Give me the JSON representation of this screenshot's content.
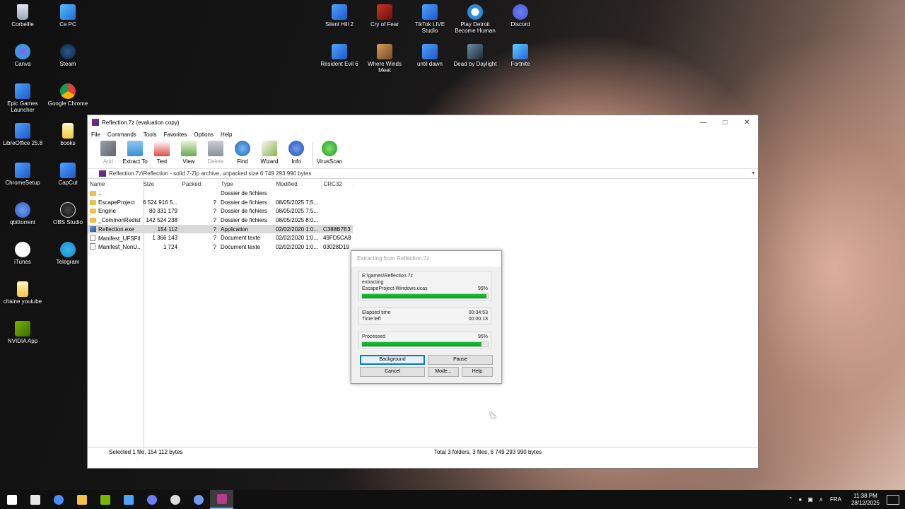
{
  "desktop": {
    "icons": [
      {
        "label": "Corbeille",
        "icon": "recycle-bin-icon"
      },
      {
        "label": "Ce PC",
        "icon": "this-pc-icon"
      },
      {
        "label": "Canva",
        "icon": "canva-icon"
      },
      {
        "label": "Steam",
        "icon": "steam-icon"
      },
      {
        "label": "Epic Games Launcher",
        "icon": "epic-games-icon"
      },
      {
        "label": "Google Chrome",
        "icon": "chrome-icon"
      },
      {
        "label": "LibreOffice 25.8",
        "icon": "libreoffice-icon"
      },
      {
        "label": "books",
        "icon": "folder-document-icon"
      },
      {
        "label": "ChromeSetup",
        "icon": "setup-icon"
      },
      {
        "label": "CapCut",
        "icon": "capcut-icon"
      },
      {
        "label": "qbittorrent",
        "icon": "qbittorrent-icon"
      },
      {
        "label": "OBS Studio",
        "icon": "obs-icon"
      },
      {
        "label": "iTunes",
        "icon": "itunes-icon"
      },
      {
        "label": "Telegram",
        "icon": "telegram-icon"
      },
      {
        "label": "chaine youtube",
        "icon": "document-icon"
      },
      {
        "label": "NVIDIA App",
        "icon": "nvidia-icon"
      },
      {
        "label": "Silent Hill 2",
        "icon": "game-shortcut-icon"
      },
      {
        "label": "Cry of Fear",
        "icon": "cry-of-fear-icon"
      },
      {
        "label": "TikTok LIVE Studio",
        "icon": "tiktok-studio-icon"
      },
      {
        "label": "Play Detroit Become Human",
        "icon": "detroit-icon"
      },
      {
        "label": "Discord",
        "icon": "discord-icon"
      },
      {
        "label": "Resident Evil 6",
        "icon": "game-shortcut-icon"
      },
      {
        "label": "Where Winds Meet",
        "icon": "where-winds-meet-icon"
      },
      {
        "label": "until dawn",
        "icon": "game-shortcut-icon"
      },
      {
        "label": "Dead by Daylight",
        "icon": "dbd-icon"
      },
      {
        "label": "Fortnite",
        "icon": "fortnite-icon"
      }
    ]
  },
  "window": {
    "title": "Reflection.7z (evaluation copy)",
    "menu": [
      "File",
      "Commands",
      "Tools",
      "Favorites",
      "Options",
      "Help"
    ],
    "toolbar": [
      {
        "label": "Add",
        "icon": "add-archive-icon",
        "disabled": true
      },
      {
        "label": "Extract To",
        "icon": "extract-folder-icon",
        "disabled": false
      },
      {
        "label": "Test",
        "icon": "test-archive-icon",
        "disabled": false
      },
      {
        "label": "View",
        "icon": "view-book-icon",
        "disabled": false
      },
      {
        "label": "Delete",
        "icon": "trash-icon",
        "disabled": true
      },
      {
        "label": "Find",
        "icon": "magnifier-icon",
        "disabled": false
      },
      {
        "label": "Wizard",
        "icon": "wizard-wand-icon",
        "disabled": false
      },
      {
        "label": "Info",
        "icon": "info-icon",
        "disabled": false
      },
      {
        "label": "VirusScan",
        "icon": "virus-scan-icon",
        "disabled": false
      }
    ],
    "address": "Reflection.7z\\Reflection - solid 7-Zip archive, unpacked size 6 749 293 990 bytes",
    "columns": [
      "Name",
      "Size",
      "Packed",
      "Type",
      "Modified",
      "CRC32"
    ],
    "files": [
      {
        "name": "..",
        "size": "",
        "packed": "",
        "type": "Dossier de fichiers",
        "modified": "",
        "crc": "",
        "kind": "folder",
        "selected": false
      },
      {
        "name": "EscapeProject",
        "size": "6 524 916 5...",
        "packed": "?",
        "type": "Dossier de fichiers",
        "modified": "08/05/2025 7:5...",
        "crc": "",
        "kind": "folder",
        "selected": false
      },
      {
        "name": "Engine",
        "size": "80 331 179",
        "packed": "?",
        "type": "Dossier de fichiers",
        "modified": "08/05/2025 7:5...",
        "crc": "",
        "kind": "folder",
        "selected": false
      },
      {
        "name": "_CommonRedist",
        "size": "142 524 238",
        "packed": "?",
        "type": "Dossier de fichiers",
        "modified": "08/05/2025 8:0...",
        "crc": "",
        "kind": "folder",
        "selected": false
      },
      {
        "name": "Reflection.exe",
        "size": "154 112",
        "packed": "?",
        "type": "Application",
        "modified": "02/02/2020 1:0...",
        "crc": "C388B7E3",
        "kind": "exe",
        "selected": true
      },
      {
        "name": "Manifest_UFSFil...",
        "size": "1 366 143",
        "packed": "?",
        "type": "Document texte",
        "modified": "02/02/2020 1:0...",
        "crc": "49FD5CA8",
        "kind": "text",
        "selected": false
      },
      {
        "name": "Manifest_NonU...",
        "size": "1 724",
        "packed": "?",
        "type": "Document texte",
        "modified": "02/02/2020 1:0...",
        "crc": "03028D19",
        "kind": "text",
        "selected": false
      }
    ],
    "status_left": "Selected 1 file, 154 112 bytes",
    "status_right": "Total 3 folders, 3 files, 6 749 293 990 bytes"
  },
  "dialog": {
    "title": "Extracting from Reflection.7z",
    "path": "E:\\games\\Reflection.7z",
    "action": "extracting",
    "current_file": "EscapeProject-Windows.ucas",
    "file_percent": "99%",
    "file_progress": 0.99,
    "elapsed_label": "Elapsed time",
    "elapsed_value": "00:04:53",
    "left_label": "Time left",
    "left_value": "00:00:13",
    "processed_label": "Processed",
    "processed_percent": "95%",
    "processed_progress": 0.95,
    "buttons": {
      "background": "Background",
      "pause": "Pause",
      "cancel": "Cancel",
      "mode": "Mode...",
      "help": "Help"
    }
  },
  "taskbar": {
    "apps": [
      {
        "icon": "windows-start-icon",
        "color": "#ffffff"
      },
      {
        "icon": "calculator-icon",
        "color": "#e6e6e6"
      },
      {
        "icon": "copilot-icon",
        "color": "#4c8cf7"
      },
      {
        "icon": "file-explorer-icon",
        "color": "#f2c046"
      },
      {
        "icon": "nvidia-icon",
        "color": "#76b900"
      },
      {
        "icon": "app-icon",
        "color": "#4ea3ff"
      },
      {
        "icon": "discord-icon",
        "color": "#6d7df3"
      },
      {
        "icon": "obs-icon",
        "color": "#dddddd"
      },
      {
        "icon": "qbittorrent-icon",
        "color": "#6f9bf2"
      },
      {
        "icon": "winrar-icon",
        "color": "#b43c8c"
      }
    ],
    "language": "FRA",
    "time": "11:38 PM",
    "date": "28/12/2025"
  }
}
